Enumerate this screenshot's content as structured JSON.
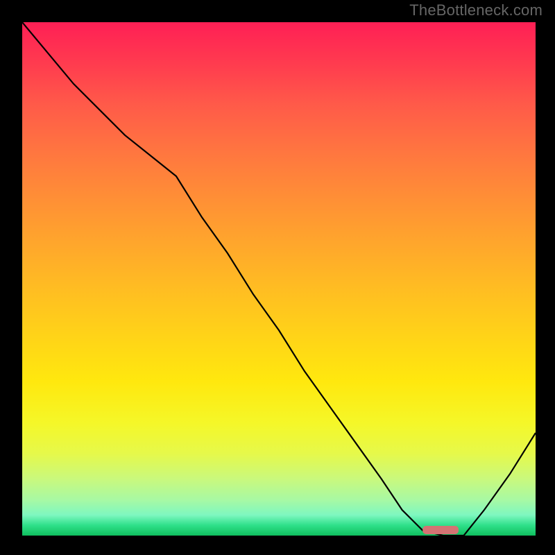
{
  "watermark": "TheBottleneck.com",
  "chart_data": {
    "type": "line",
    "title": "",
    "xlabel": "",
    "ylabel": "",
    "xlim": [
      0,
      100
    ],
    "ylim": [
      0,
      100
    ],
    "grid": false,
    "legend": "none",
    "series": [
      {
        "name": "bottleneck-curve",
        "x": [
          0,
          5,
          10,
          15,
          20,
          25,
          30,
          35,
          40,
          45,
          50,
          55,
          60,
          65,
          70,
          74,
          78,
          82,
          86,
          90,
          95,
          100
        ],
        "y": [
          100,
          94,
          88,
          83,
          78,
          74,
          70,
          62,
          55,
          47,
          40,
          32,
          25,
          18,
          11,
          5,
          1,
          0,
          0,
          5,
          12,
          20
        ]
      }
    ],
    "marker": {
      "name": "optimal-range",
      "x_start": 78,
      "x_end": 85,
      "y": 0,
      "color": "#d47373"
    },
    "gradient_stops": [
      {
        "pos": 0.0,
        "color": "#ff1f55"
      },
      {
        "pos": 0.5,
        "color": "#ffd318"
      },
      {
        "pos": 0.8,
        "color": "#f5f728"
      },
      {
        "pos": 1.0,
        "color": "#0fbf5e"
      }
    ]
  }
}
